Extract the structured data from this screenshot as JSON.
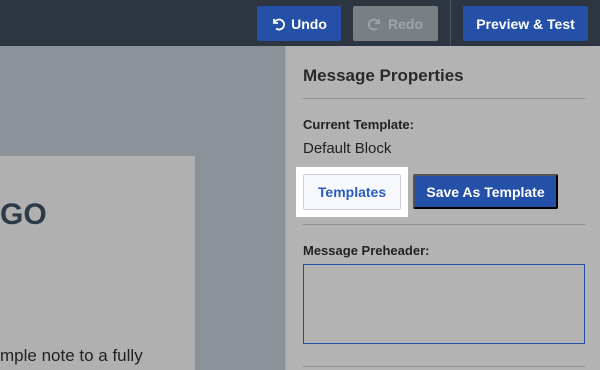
{
  "toolbar": {
    "undo_label": "Undo",
    "redo_label": "Redo",
    "preview_label": "Preview & Test"
  },
  "canvas": {
    "heading_fragment": "GO",
    "body_fragment": "mple note to a fully"
  },
  "panel": {
    "title": "Message Properties",
    "current_template_label": "Current Template:",
    "current_template_value": "Default Block",
    "templates_button": "Templates",
    "save_template_button": "Save As Template",
    "preheader_label": "Message Preheader:",
    "preheader_value": ""
  },
  "colors": {
    "primary": "#2450a8",
    "toolbar_bg": "#2d3540",
    "panel_bg": "#b3b3b3"
  },
  "icons": {
    "undo": "undo-icon",
    "redo": "redo-icon"
  }
}
